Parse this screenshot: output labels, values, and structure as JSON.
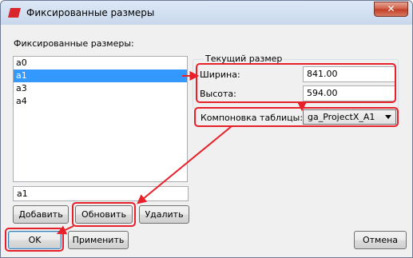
{
  "window": {
    "title": "Фиксированные размеры",
    "close_label": "✕"
  },
  "list_section": {
    "label": "Фиксированные размеры:"
  },
  "sizes": [
    {
      "label": "a0",
      "selected": false
    },
    {
      "label": "a1",
      "selected": true
    },
    {
      "label": "a3",
      "selected": false
    },
    {
      "label": "a4",
      "selected": false
    }
  ],
  "name_input": {
    "value": "a1"
  },
  "current_size": {
    "title": "Текущий размер",
    "width_label": "Ширина:",
    "width_value": "841.00",
    "height_label": "Высота:",
    "height_value": "594.00"
  },
  "layout": {
    "label": "Компоновка таблицы:",
    "selected": "ga_ProjectX_A1"
  },
  "buttons": {
    "add": "Добавить",
    "update": "Обновить",
    "delete": "Удалить",
    "ok": "OK",
    "apply": "Применить",
    "cancel": "Отмена"
  },
  "annotation_color": "#e8202a"
}
